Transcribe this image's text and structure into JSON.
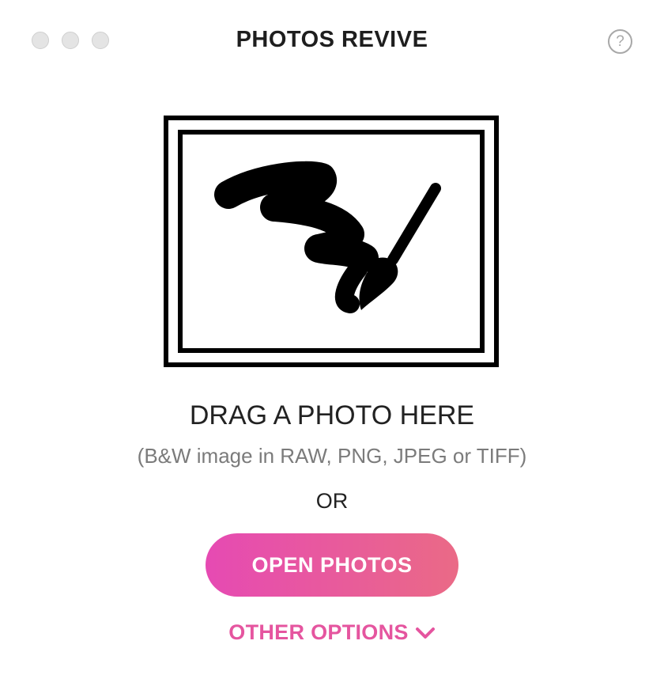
{
  "window": {
    "title": "PHOTOS REVIVE",
    "traffic_lights": [
      "close",
      "minimize",
      "zoom"
    ],
    "help_label": "?"
  },
  "drop_zone": {
    "icon": "framed-brush-stroke-icon",
    "heading": "DRAG A PHOTO HERE",
    "formats": "(B&W image in RAW, PNG, JPEG or TIFF)",
    "separator": "OR"
  },
  "actions": {
    "open_label": "OPEN PHOTOS",
    "other_label": "OTHER OPTIONS",
    "other_icon": "chevron-down-icon"
  },
  "colors": {
    "accent_start": "#e64ab3",
    "accent_end": "#ea6a86",
    "accent_text": "#e5559f"
  }
}
